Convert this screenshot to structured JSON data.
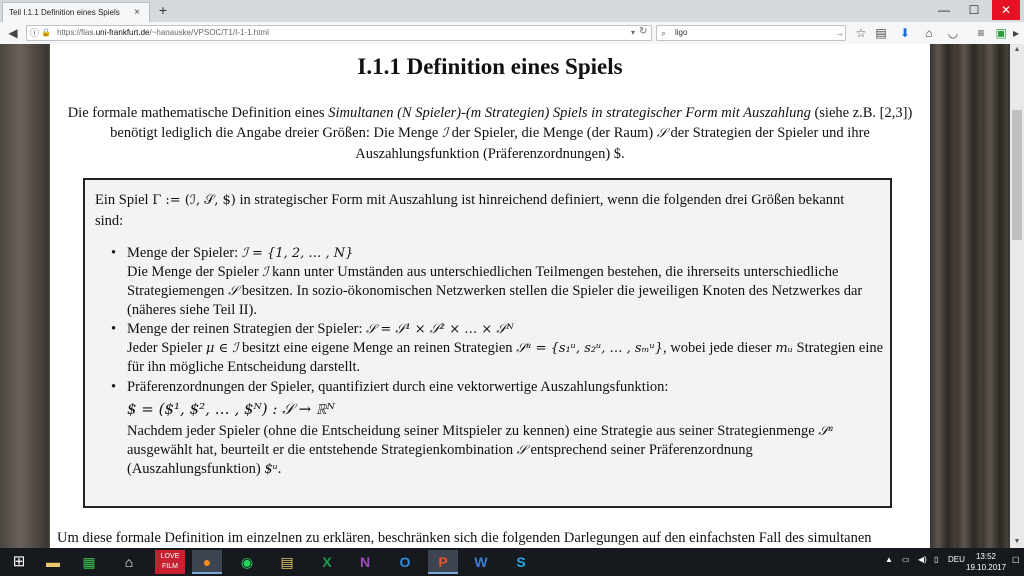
{
  "browser": {
    "tab_title": "Teil I.1.1 Definition eines Spiels",
    "tab_close": "×",
    "new_tab": "+",
    "url_prefix": "https://fias.",
    "url_host": "uni-frankfurt.de",
    "url_path": "/~hanauske/VPSOC/T1/I-1-1.html",
    "search_value": "ligo"
  },
  "page": {
    "heading": "I.1.1 Definition eines Spiels",
    "intro": {
      "p1": "Die formale mathematische Definition eines ",
      "em1": "Simultanen (N Spieler)-(m Strategien) Spiels in strategischer Form mit Auszahlung",
      "p2": " (siehe z.B. [2,3]) benötigt lediglich die Angabe dreier Größen: Die Menge ",
      "sym_I": "ℐ",
      "p3": " der Spieler, die Menge (der Raum) ",
      "sym_S": "𝒮",
      "p4": " der Strategien der Spieler und ihre Auszahlungsfunktion (Präferenzordnungen) $."
    },
    "box": {
      "lead_1": "Ein Spiel ",
      "lead_math": "Γ := (ℐ, 𝒮, $)",
      "lead_2": " in strategischer Form mit Auszahlung ist hinreichend definiert, wenn die folgenden drei Größen bekannt sind:",
      "bullet_symbol": "•",
      "b1_title": "Menge der Spieler: ",
      "b1_math": "ℐ = {1, 2, … , N}",
      "b1_text_1": "Die Menge der Spieler ",
      "b1_text_sym": "ℐ",
      "b1_text_2": " kann unter Umständen aus unterschiedlichen Teilmengen bestehen, die ihrerseits unterschiedliche Strategiemengen ",
      "b1_text_sym2": "𝒮",
      "b1_text_3": " besitzen. In sozio-ökonomischen Netzwerken stellen die Spieler die jeweiligen Knoten des Netzwerkes dar (näheres siehe Teil II).",
      "b2_title": "Menge der reinen Strategien der Spieler: ",
      "b2_math": "𝒮 = 𝒮¹ × 𝒮² × … × 𝒮ᴺ",
      "b2_text_1": "Jeder Spieler ",
      "b2_text_math": "μ ∈ ℐ",
      "b2_text_2": " besitzt eine eigene Menge an reinen Strategien ",
      "b2_text_math2": "𝒮ᵘ = {s₁ᵘ, s₂ᵘ, … , sₘᵘ}",
      "b2_text_3": ", wobei jede dieser ",
      "b2_text_math3": "mᵤ",
      "b2_text_4": " Strategien eine für ihn mögliche Entscheidung darstellt.",
      "b3_title": "Präferenzordnungen der Spieler, quantifiziert durch eine vektorwertige Auszahlungsfunktion:",
      "b3_math": "$ = ($¹, $², … , $ᴺ) : 𝒮 → ℝᴺ",
      "b3_text_1": "Nachdem jeder Spieler (ohne die Entscheidung seiner Mitspieler zu kennen) eine Strategie aus seiner Strategienmenge ",
      "b3_text_math": "𝒮ᵘ",
      "b3_text_2": " ausgewählt hat, beurteilt er die entstehende Strategienkombination ",
      "b3_text_sym": "𝒮",
      "b3_text_3": " entsprechend seiner Präferenzordnung (Auszahlungsfunktion) ",
      "b3_text_math2": "$ᵘ",
      "b3_text_4": "."
    },
    "outro": "Um diese formale Definition im einzelnen zu erklären, beschränken sich die folgenden Darlegungen auf den einfachsten Fall des simultanen"
  },
  "taskbar": {
    "lang": "DEU",
    "time": "13:52",
    "date": "19.10.2017",
    "apps": [
      "windows-start",
      "file-explorer",
      "store",
      "home",
      "lovefilm",
      "firefox",
      "spotify",
      "notes",
      "excel",
      "onenote",
      "outlook",
      "powerpoint",
      "word",
      "skype"
    ]
  }
}
